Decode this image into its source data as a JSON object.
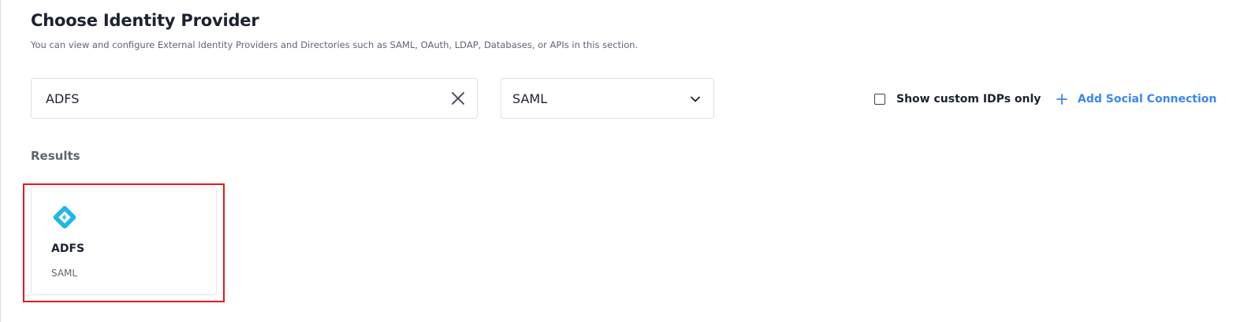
{
  "header": {
    "title": "Choose Identity Provider",
    "subtitle": "You can view and configure External Identity Providers and Directories such as SAML, OAuth, LDAP, Databases, or APIs in this section."
  },
  "search": {
    "value": "ADFS",
    "clear_icon": "close-icon"
  },
  "protocol_filter": {
    "selected": "SAML",
    "icon": "chevron-down-icon"
  },
  "filters": {
    "custom_only_label": "Show custom IDPs only",
    "custom_only_checked": false
  },
  "actions": {
    "add_social_label": "Add Social Connection",
    "add_icon": "plus-icon"
  },
  "results": {
    "heading": "Results",
    "items": [
      {
        "name": "ADFS",
        "protocol": "SAML",
        "icon": "adfs-logo-icon"
      }
    ]
  },
  "colors": {
    "accent": "#3a86f0",
    "highlight": "#e11b1b",
    "adfs_logo": "#1fb6ea"
  }
}
